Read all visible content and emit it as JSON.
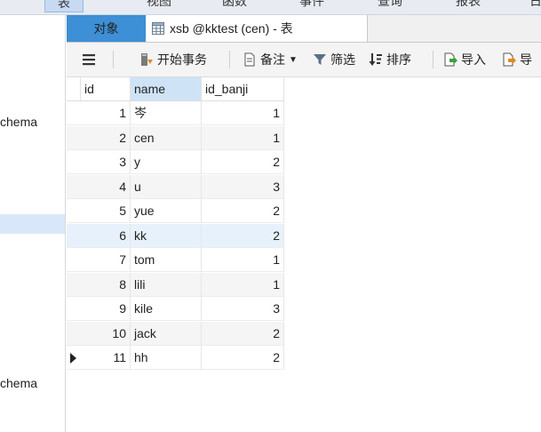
{
  "menu": {
    "items": [
      "表",
      "视图",
      "函数",
      "事件",
      "查询",
      "报表"
    ]
  },
  "left_pane": {
    "items": [
      "chema",
      "chema"
    ]
  },
  "tabs": {
    "objects_label": "对象",
    "table_tab_title": "xsb @kktest (cen) - 表"
  },
  "toolbar": {
    "begin_transaction": "开始事务",
    "note": "备注",
    "filter": "筛选",
    "sort": "排序",
    "import": "导入",
    "export": "导"
  },
  "grid": {
    "columns": [
      "id",
      "name",
      "id_banji"
    ],
    "rows": [
      {
        "id": "1",
        "name": "岑",
        "id_banji": "1"
      },
      {
        "id": "2",
        "name": "cen",
        "id_banji": "1"
      },
      {
        "id": "3",
        "name": "y",
        "id_banji": "2"
      },
      {
        "id": "4",
        "name": "u",
        "id_banji": "3"
      },
      {
        "id": "5",
        "name": "yue",
        "id_banji": "2"
      },
      {
        "id": "6",
        "name": "kk",
        "id_banji": "2"
      },
      {
        "id": "7",
        "name": "tom",
        "id_banji": "1"
      },
      {
        "id": "8",
        "name": "lili",
        "id_banji": "1"
      },
      {
        "id": "9",
        "name": "kile",
        "id_banji": "3"
      },
      {
        "id": "10",
        "name": "jack",
        "id_banji": "2"
      },
      {
        "id": "11",
        "name": "hh",
        "id_banji": "2"
      }
    ]
  }
}
